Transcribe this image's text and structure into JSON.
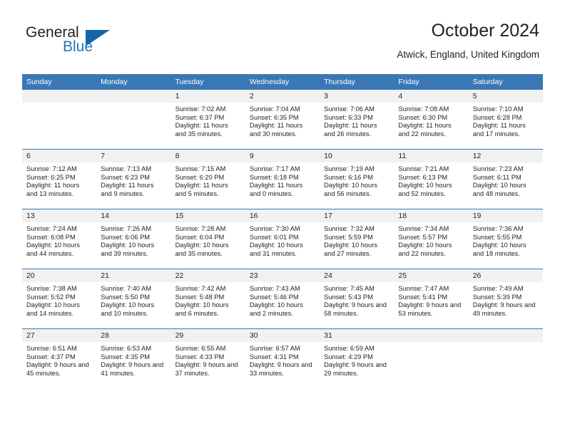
{
  "logo": {
    "word_one": "General",
    "word_two": "Blue",
    "triangle_color": "#1565a8",
    "blue_color": "#2277bb"
  },
  "header": {
    "title": "October 2024",
    "subtitle": "Atwick, England, United Kingdom"
  },
  "theme": {
    "header_blue": "#3a78b5",
    "daynum_gray": "#f1f1f1",
    "text": "#231f20"
  },
  "weekday_headers": [
    "Sunday",
    "Monday",
    "Tuesday",
    "Wednesday",
    "Thursday",
    "Friday",
    "Saturday"
  ],
  "weeks": [
    {
      "days": [
        {
          "date": "",
          "sunrise": "",
          "sunset": "",
          "daylight": "",
          "empty": true
        },
        {
          "date": "",
          "sunrise": "",
          "sunset": "",
          "daylight": "",
          "empty": true
        },
        {
          "date": "1",
          "sunrise": "Sunrise: 7:02 AM",
          "sunset": "Sunset: 6:37 PM",
          "daylight": "Daylight: 11 hours and 35 minutes.",
          "empty": false
        },
        {
          "date": "2",
          "sunrise": "Sunrise: 7:04 AM",
          "sunset": "Sunset: 6:35 PM",
          "daylight": "Daylight: 11 hours and 30 minutes.",
          "empty": false
        },
        {
          "date": "3",
          "sunrise": "Sunrise: 7:06 AM",
          "sunset": "Sunset: 6:33 PM",
          "daylight": "Daylight: 11 hours and 26 minutes.",
          "empty": false
        },
        {
          "date": "4",
          "sunrise": "Sunrise: 7:08 AM",
          "sunset": "Sunset: 6:30 PM",
          "daylight": "Daylight: 11 hours and 22 minutes.",
          "empty": false
        },
        {
          "date": "5",
          "sunrise": "Sunrise: 7:10 AM",
          "sunset": "Sunset: 6:28 PM",
          "daylight": "Daylight: 11 hours and 17 minutes.",
          "empty": false
        }
      ]
    },
    {
      "days": [
        {
          "date": "6",
          "sunrise": "Sunrise: 7:12 AM",
          "sunset": "Sunset: 6:25 PM",
          "daylight": "Daylight: 11 hours and 13 minutes.",
          "empty": false
        },
        {
          "date": "7",
          "sunrise": "Sunrise: 7:13 AM",
          "sunset": "Sunset: 6:23 PM",
          "daylight": "Daylight: 11 hours and 9 minutes.",
          "empty": false
        },
        {
          "date": "8",
          "sunrise": "Sunrise: 7:15 AM",
          "sunset": "Sunset: 6:20 PM",
          "daylight": "Daylight: 11 hours and 5 minutes.",
          "empty": false
        },
        {
          "date": "9",
          "sunrise": "Sunrise: 7:17 AM",
          "sunset": "Sunset: 6:18 PM",
          "daylight": "Daylight: 11 hours and 0 minutes.",
          "empty": false
        },
        {
          "date": "10",
          "sunrise": "Sunrise: 7:19 AM",
          "sunset": "Sunset: 6:16 PM",
          "daylight": "Daylight: 10 hours and 56 minutes.",
          "empty": false
        },
        {
          "date": "11",
          "sunrise": "Sunrise: 7:21 AM",
          "sunset": "Sunset: 6:13 PM",
          "daylight": "Daylight: 10 hours and 52 minutes.",
          "empty": false
        },
        {
          "date": "12",
          "sunrise": "Sunrise: 7:23 AM",
          "sunset": "Sunset: 6:11 PM",
          "daylight": "Daylight: 10 hours and 48 minutes.",
          "empty": false
        }
      ]
    },
    {
      "days": [
        {
          "date": "13",
          "sunrise": "Sunrise: 7:24 AM",
          "sunset": "Sunset: 6:08 PM",
          "daylight": "Daylight: 10 hours and 44 minutes.",
          "empty": false
        },
        {
          "date": "14",
          "sunrise": "Sunrise: 7:26 AM",
          "sunset": "Sunset: 6:06 PM",
          "daylight": "Daylight: 10 hours and 39 minutes.",
          "empty": false
        },
        {
          "date": "15",
          "sunrise": "Sunrise: 7:28 AM",
          "sunset": "Sunset: 6:04 PM",
          "daylight": "Daylight: 10 hours and 35 minutes.",
          "empty": false
        },
        {
          "date": "16",
          "sunrise": "Sunrise: 7:30 AM",
          "sunset": "Sunset: 6:01 PM",
          "daylight": "Daylight: 10 hours and 31 minutes.",
          "empty": false
        },
        {
          "date": "17",
          "sunrise": "Sunrise: 7:32 AM",
          "sunset": "Sunset: 5:59 PM",
          "daylight": "Daylight: 10 hours and 27 minutes.",
          "empty": false
        },
        {
          "date": "18",
          "sunrise": "Sunrise: 7:34 AM",
          "sunset": "Sunset: 5:57 PM",
          "daylight": "Daylight: 10 hours and 22 minutes.",
          "empty": false
        },
        {
          "date": "19",
          "sunrise": "Sunrise: 7:36 AM",
          "sunset": "Sunset: 5:55 PM",
          "daylight": "Daylight: 10 hours and 18 minutes.",
          "empty": false
        }
      ]
    },
    {
      "days": [
        {
          "date": "20",
          "sunrise": "Sunrise: 7:38 AM",
          "sunset": "Sunset: 5:52 PM",
          "daylight": "Daylight: 10 hours and 14 minutes.",
          "empty": false
        },
        {
          "date": "21",
          "sunrise": "Sunrise: 7:40 AM",
          "sunset": "Sunset: 5:50 PM",
          "daylight": "Daylight: 10 hours and 10 minutes.",
          "empty": false
        },
        {
          "date": "22",
          "sunrise": "Sunrise: 7:42 AM",
          "sunset": "Sunset: 5:48 PM",
          "daylight": "Daylight: 10 hours and 6 minutes.",
          "empty": false
        },
        {
          "date": "23",
          "sunrise": "Sunrise: 7:43 AM",
          "sunset": "Sunset: 5:46 PM",
          "daylight": "Daylight: 10 hours and 2 minutes.",
          "empty": false
        },
        {
          "date": "24",
          "sunrise": "Sunrise: 7:45 AM",
          "sunset": "Sunset: 5:43 PM",
          "daylight": "Daylight: 9 hours and 58 minutes.",
          "empty": false
        },
        {
          "date": "25",
          "sunrise": "Sunrise: 7:47 AM",
          "sunset": "Sunset: 5:41 PM",
          "daylight": "Daylight: 9 hours and 53 minutes.",
          "empty": false
        },
        {
          "date": "26",
          "sunrise": "Sunrise: 7:49 AM",
          "sunset": "Sunset: 5:39 PM",
          "daylight": "Daylight: 9 hours and 49 minutes.",
          "empty": false
        }
      ]
    },
    {
      "days": [
        {
          "date": "27",
          "sunrise": "Sunrise: 6:51 AM",
          "sunset": "Sunset: 4:37 PM",
          "daylight": "Daylight: 9 hours and 45 minutes.",
          "empty": false
        },
        {
          "date": "28",
          "sunrise": "Sunrise: 6:53 AM",
          "sunset": "Sunset: 4:35 PM",
          "daylight": "Daylight: 9 hours and 41 minutes.",
          "empty": false
        },
        {
          "date": "29",
          "sunrise": "Sunrise: 6:55 AM",
          "sunset": "Sunset: 4:33 PM",
          "daylight": "Daylight: 9 hours and 37 minutes.",
          "empty": false
        },
        {
          "date": "30",
          "sunrise": "Sunrise: 6:57 AM",
          "sunset": "Sunset: 4:31 PM",
          "daylight": "Daylight: 9 hours and 33 minutes.",
          "empty": false
        },
        {
          "date": "31",
          "sunrise": "Sunrise: 6:59 AM",
          "sunset": "Sunset: 4:29 PM",
          "daylight": "Daylight: 9 hours and 29 minutes.",
          "empty": false
        },
        {
          "date": "",
          "sunrise": "",
          "sunset": "",
          "daylight": "",
          "empty": true
        },
        {
          "date": "",
          "sunrise": "",
          "sunset": "",
          "daylight": "",
          "empty": true
        }
      ]
    }
  ]
}
